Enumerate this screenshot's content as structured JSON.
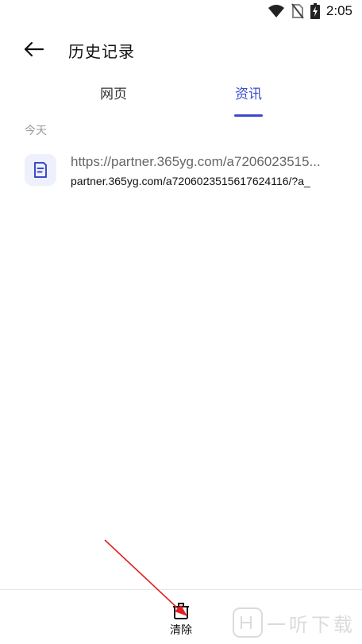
{
  "status_bar": {
    "time": "2:05",
    "icons": [
      "wifi-icon",
      "no-sim-icon",
      "battery-charging-icon"
    ]
  },
  "header": {
    "back_icon": "arrow-left-icon",
    "title": "历史记录"
  },
  "tabs": [
    {
      "label": "网页",
      "active": false
    },
    {
      "label": "资讯",
      "active": true
    }
  ],
  "accent_color": "#3a4bc9",
  "history": {
    "section_label": "今天",
    "items": [
      {
        "icon": "document-icon",
        "title": "https://partner.365yg.com/a7206023515...",
        "url": "partner.365yg.com/a7206023515617624116/?a_"
      }
    ]
  },
  "bottom_bar": {
    "clear_icon": "trash-icon",
    "clear_label": "清除"
  },
  "watermark": {
    "text": "一听下载"
  }
}
